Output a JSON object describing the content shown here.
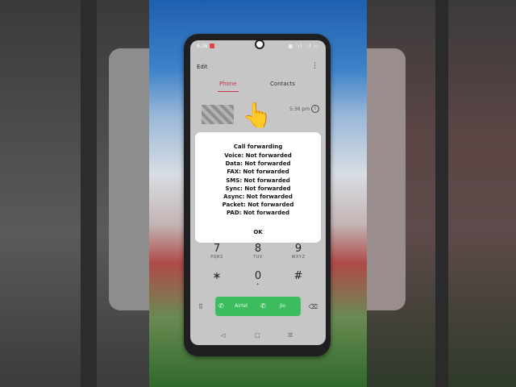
{
  "status_bar": {
    "time": "6:26",
    "icons": "▦ .ıl .ıl ▭"
  },
  "toolbar": {
    "edit_label": "Edit",
    "more_icon": "⋮"
  },
  "tabs": [
    {
      "label": "Phone",
      "active": true
    },
    {
      "label": "Contacts",
      "active": false
    }
  ],
  "recent_call": {
    "label": "si",
    "time": "5:36 pm",
    "info_icon": "i"
  },
  "pointer_emoji": "👆",
  "dialog": {
    "title": "Call forwarding",
    "lines": [
      "Voice: Not forwarded",
      "Data: Not forwarded",
      "FAX: Not forwarded",
      "SMS: Not forwarded",
      "Sync: Not forwarded",
      "Async: Not forwarded",
      "Packet: Not forwarded",
      "PAD: Not forwarded"
    ],
    "ok_label": "OK"
  },
  "keypad": [
    {
      "digit": "7",
      "letters": "PQRS"
    },
    {
      "digit": "8",
      "letters": "TUV"
    },
    {
      "digit": "9",
      "letters": "WXYZ"
    },
    {
      "digit": "∗",
      "letters": ""
    },
    {
      "digit": "0",
      "letters": "+"
    },
    {
      "digit": "#",
      "letters": ""
    }
  ],
  "call_bar": {
    "sim1_label": "Airtel",
    "sim2_label": "Jio",
    "phone_icon": "✆"
  },
  "icons": {
    "dialpad": "⠿",
    "delete": "⌫"
  },
  "navbar": {
    "back": "◁",
    "home": "□",
    "recents": "☰"
  },
  "colors": {
    "accent": "#c9334a",
    "call_green": "#3dbb5f"
  }
}
